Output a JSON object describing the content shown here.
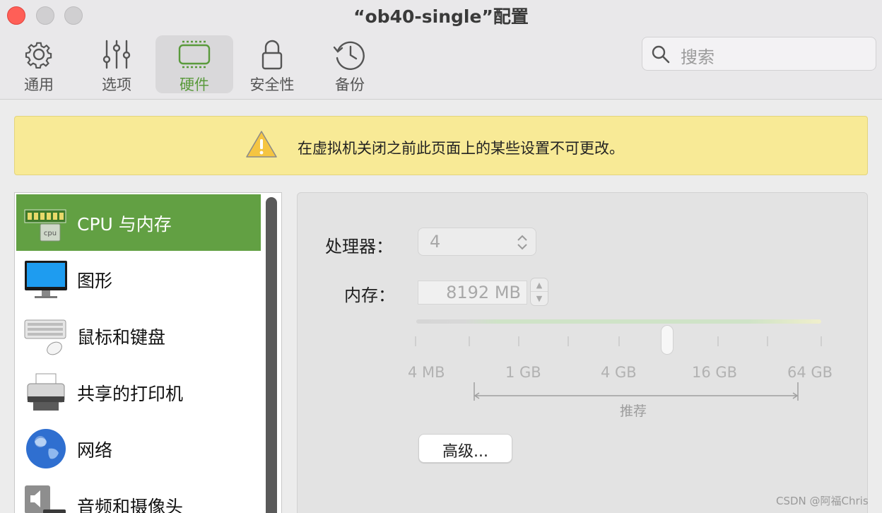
{
  "window": {
    "title": "“ob40-single”配置"
  },
  "toolbar": {
    "items": [
      {
        "label": "通用",
        "icon": "gear-icon"
      },
      {
        "label": "选项",
        "icon": "sliders-icon"
      },
      {
        "label": "硬件",
        "icon": "hardware-icon",
        "active": true
      },
      {
        "label": "安全性",
        "icon": "lock-icon"
      },
      {
        "label": "备份",
        "icon": "history-icon"
      }
    ],
    "accent_color": "#5a9a3c"
  },
  "search": {
    "placeholder": "搜索"
  },
  "banner": {
    "text": "在虚拟机关闭之前此页面上的某些设置不可更改。",
    "icon": "warning-icon"
  },
  "sidebar": {
    "items": [
      {
        "label": "CPU 与内存",
        "icon": "cpu-memory-icon",
        "selected": true
      },
      {
        "label": "图形",
        "icon": "display-icon"
      },
      {
        "label": "鼠标和键盘",
        "icon": "keyboard-mouse-icon"
      },
      {
        "label": "共享的打印机",
        "icon": "printer-icon"
      },
      {
        "label": "网络",
        "icon": "globe-icon"
      },
      {
        "label": "音频和摄像头",
        "icon": "speaker-camera-icon"
      }
    ],
    "selected_color": "#62a043"
  },
  "cpu": {
    "processor_label": "处理器：",
    "processor_value": "4",
    "memory_label": "内存：",
    "memory_value": "8192 MB"
  },
  "memory_slider": {
    "scale_labels": [
      "4 MB",
      "1 GB",
      "4 GB",
      "16 GB",
      "64 GB"
    ],
    "recommended_label": "推荐",
    "value_mb": 8192
  },
  "advanced_button": {
    "label": "高级..."
  },
  "watermark": "CSDN @阿福Chris"
}
